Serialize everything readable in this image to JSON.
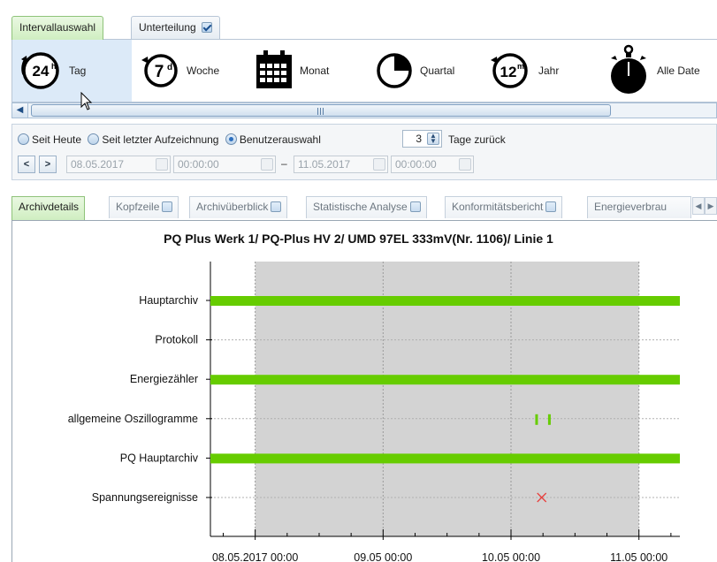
{
  "top_tabs": [
    {
      "label": "Intervallauswahl",
      "active": true
    },
    {
      "label": "Unterteilung",
      "checked": true
    }
  ],
  "intervals": [
    {
      "label": "Tag",
      "icon": "clock-24h-icon",
      "glyph": "24h",
      "selected": true
    },
    {
      "label": "Woche",
      "icon": "clock-7d-icon",
      "glyph": "7d"
    },
    {
      "label": "Monat",
      "icon": "calendar-icon"
    },
    {
      "label": "Quartal",
      "icon": "pie-quarter-icon"
    },
    {
      "label": "Jahr",
      "icon": "clock-12m-icon",
      "glyph": "12m"
    },
    {
      "label": "Alle Date",
      "icon": "stopwatch-icon"
    }
  ],
  "range": {
    "options": [
      {
        "label": "Seit Heute",
        "checked": false
      },
      {
        "label": "Seit letzter Aufzeichnung",
        "checked": false
      },
      {
        "label": "Benutzerauswahl",
        "checked": true
      }
    ],
    "days_back_value": "3",
    "days_back_label": "Tage zurück",
    "prev_label": "<",
    "next_label": ">",
    "from_date": "08.05.2017",
    "from_time": "00:00:00",
    "separator": "–",
    "to_date": "11.05.2017",
    "to_time": "00:00:00"
  },
  "bottom_tabs": [
    {
      "label": "Archivdetails",
      "active": true
    },
    {
      "label": "Kopfzeile"
    },
    {
      "label": "Archivüberblick"
    },
    {
      "label": "Statistische Analyse"
    },
    {
      "label": "Konformitätsbericht"
    },
    {
      "label": "Energieverbrau"
    }
  ],
  "chart_data": {
    "type": "timeline",
    "title": "PQ Plus Werk 1/ PQ-Plus HV 2/ UMD 97EL 333mV(Nr. 1106)/ Linie 1",
    "categories": [
      "Hauptarchiv",
      "Protokoll",
      "Energiezähler",
      "allgemeine Oszillogramme",
      "PQ Hauptarchiv",
      "Spannungsereignisse"
    ],
    "x_ticks": [
      "08.05.2017 00:00",
      "09.05 00:00",
      "10.05 00:00",
      "11.05 00:00"
    ],
    "xlim_days": [
      7.65,
      11.32
    ],
    "selected_range": [
      "08.05.2017 00:00",
      "11.05 00:00"
    ],
    "bars": [
      {
        "category": "Hauptarchiv",
        "start_day": 7.65,
        "end_day": 11.32
      },
      {
        "category": "Energiezähler",
        "start_day": 7.65,
        "end_day": 11.32
      },
      {
        "category": "PQ Hauptarchiv",
        "start_day": 7.65,
        "end_day": 11.32
      }
    ],
    "ticks_marks": [
      {
        "category": "allgemeine Oszillogramme",
        "day": 10.2
      },
      {
        "category": "allgemeine Oszillogramme",
        "day": 10.3
      }
    ],
    "events": [
      {
        "category": "Spannungsereignisse",
        "day": 10.24,
        "marker": "x"
      }
    ],
    "colors": {
      "bar": "#66cc00",
      "selection": "#d3d3d3",
      "event": "#e8413e"
    },
    "grid": true
  }
}
